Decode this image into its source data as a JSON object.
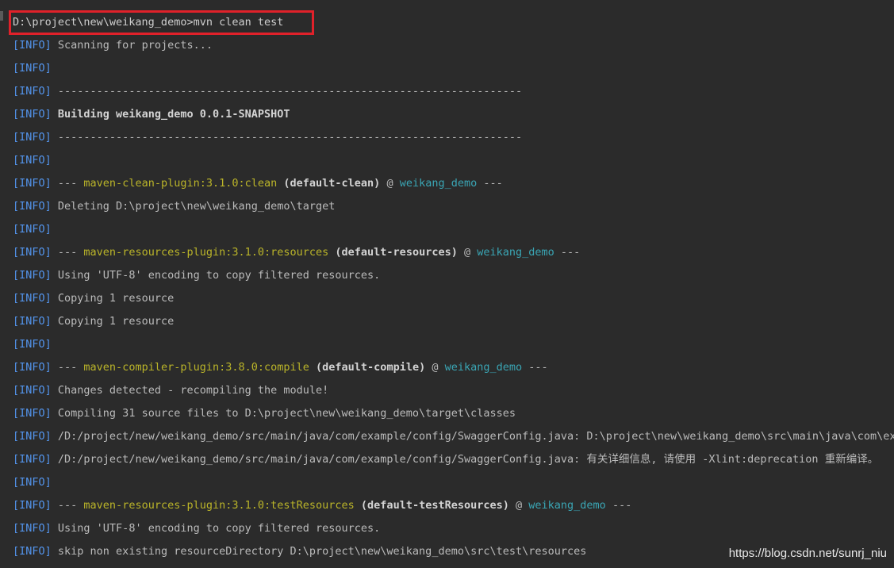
{
  "command": "D:\\project\\new\\weikang_demo>mvn clean test",
  "watermark": "https://blog.csdn.net/sunrj_niu",
  "colors": {
    "background": "#2b2b2b",
    "info_tag": "#5394ec",
    "plugin": "#bbb529",
    "project": "#3aa6b5",
    "highlight_border": "#e0212a"
  },
  "lines": [
    {
      "tag": "[INFO]",
      "text": " Scanning for projects..."
    },
    {
      "tag": "[INFO]",
      "text": ""
    },
    {
      "tag": "[INFO]",
      "text": " ------------------------------------------------------------------------"
    },
    {
      "tag": "[INFO]",
      "text": " Building weikang_demo 0.0.1-SNAPSHOT",
      "bold": true
    },
    {
      "tag": "[INFO]",
      "text": " ------------------------------------------------------------------------"
    },
    {
      "tag": "[INFO]",
      "text": ""
    },
    {
      "tag": "[INFO]",
      "plugin_line": true,
      "prefix": " --- ",
      "plugin": "maven-clean-plugin:3.1.0:clean",
      "execid": " (default-clean)",
      "at": " @ ",
      "project": "weikang_demo",
      "suffix": " ---"
    },
    {
      "tag": "[INFO]",
      "text": " Deleting D:\\project\\new\\weikang_demo\\target"
    },
    {
      "tag": "[INFO]",
      "text": ""
    },
    {
      "tag": "[INFO]",
      "plugin_line": true,
      "prefix": " --- ",
      "plugin": "maven-resources-plugin:3.1.0:resources",
      "execid": " (default-resources)",
      "at": " @ ",
      "project": "weikang_demo",
      "suffix": " ---"
    },
    {
      "tag": "[INFO]",
      "text": " Using 'UTF-8' encoding to copy filtered resources."
    },
    {
      "tag": "[INFO]",
      "text": " Copying 1 resource"
    },
    {
      "tag": "[INFO]",
      "text": " Copying 1 resource"
    },
    {
      "tag": "[INFO]",
      "text": ""
    },
    {
      "tag": "[INFO]",
      "plugin_line": true,
      "prefix": " --- ",
      "plugin": "maven-compiler-plugin:3.8.0:compile",
      "execid": " (default-compile)",
      "at": " @ ",
      "project": "weikang_demo",
      "suffix": " ---"
    },
    {
      "tag": "[INFO]",
      "text": " Changes detected - recompiling the module!"
    },
    {
      "tag": "[INFO]",
      "text": " Compiling 31 source files to D:\\project\\new\\weikang_demo\\target\\classes"
    },
    {
      "tag": "[INFO]",
      "text": " /D:/project/new/weikang_demo/src/main/java/com/example/config/SwaggerConfig.java: D:\\project\\new\\weikang_demo\\src\\main\\java\\com\\example\\config\\SwaggerConfig.java使用或覆盖了已过时的 API。"
    },
    {
      "tag": "[INFO]",
      "text": " /D:/project/new/weikang_demo/src/main/java/com/example/config/SwaggerConfig.java: 有关详细信息, 请使用 -Xlint:deprecation 重新编译。"
    },
    {
      "tag": "[INFO]",
      "text": ""
    },
    {
      "tag": "[INFO]",
      "plugin_line": true,
      "prefix": " --- ",
      "plugin": "maven-resources-plugin:3.1.0:testResources",
      "execid": " (default-testResources)",
      "at": " @ ",
      "project": "weikang_demo",
      "suffix": " ---"
    },
    {
      "tag": "[INFO]",
      "text": " Using 'UTF-8' encoding to copy filtered resources."
    },
    {
      "tag": "[INFO]",
      "text": " skip non existing resourceDirectory D:\\project\\new\\weikang_demo\\src\\test\\resources"
    }
  ]
}
